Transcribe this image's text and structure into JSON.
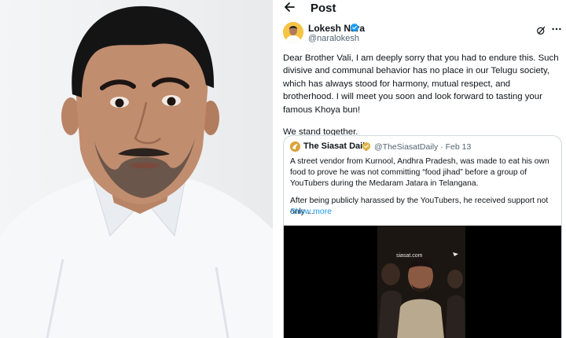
{
  "header": {
    "title": "Post"
  },
  "author": {
    "name": "Lokesh Nara",
    "handle": "@naralokesh"
  },
  "tweet": {
    "paragraph1": "Dear Brother Vali, I am deeply sorry that you had to endure this. Such divisive and communal behavior has no place in our Telugu society, which has always stood for harmony, mutual respect, and brotherhood. I will meet you soon and look forward to tasting your famous Khoya bun!",
    "paragraph2": "We stand together."
  },
  "quote": {
    "name": "The Siasat Daily",
    "meta": "@TheSiasatDaily · Feb 13",
    "paragraph1": "A street vendor from Kurnool, Andhra Pradesh, was made to eat his own food to prove he was not committing “food jihad” before a group of YouTubers during the Medaram Jatara in Telangana.",
    "paragraph2": "After being publicly harassed by the YouTubers, he received support not only ...",
    "show_more": "Show more",
    "media_watermark": "siasat.com"
  },
  "icons": {
    "back": "arrow-left-icon",
    "verified": "verified-badge-icon",
    "grok": "grok-icon",
    "more": "more-options-icon"
  },
  "colors": {
    "verified": "#1d9bf0",
    "link": "#1d9bf0",
    "secondary_text": "#536471",
    "border": "#cfd9de"
  }
}
